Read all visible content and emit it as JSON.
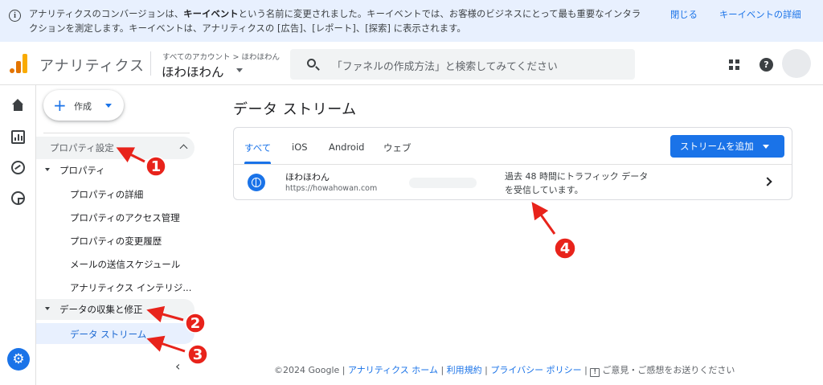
{
  "banner": {
    "message_pre": "アナリティクスのコンバージョンは、",
    "message_bold": "キーイベント",
    "message_post": "という名前に変更されました。キーイベントでは、お客様のビジネスにとって最も重要なインタラクションを測定します。キーイベントは、アナリティクスの [広告]、[レポート]、[探索] に表示されます。",
    "close_label": "閉じる",
    "details_label": "キーイベントの詳細"
  },
  "header": {
    "app_name": "アナリティクス",
    "breadcrumb": "すべてのアカウント > ほわほわん",
    "property_name": "ほわほわん",
    "search_placeholder": "「ファネルの作成方法」と検索してみてください"
  },
  "admin_nav": {
    "create_label": "作成",
    "section_label": "プロパティ設定",
    "group1_label": "プロパティ",
    "group1_items": [
      "プロパティの詳細",
      "プロパティのアクセス管理",
      "プロパティの変更履歴",
      "メールの送信スケジュール",
      "アナリティクス インテリジ..."
    ],
    "group2_label": "データの収集と修正",
    "group2_items": [
      "データ ストリーム"
    ]
  },
  "main": {
    "page_title": "データ ストリーム",
    "tabs": [
      "すべて",
      "iOS",
      "Android",
      "ウェブ"
    ],
    "add_stream_label": "ストリームを追加",
    "stream": {
      "name": "ほわほわん",
      "url": "https://howahowan.com",
      "status": "過去 48 時間にトラフィック データを受信しています。"
    }
  },
  "footer": {
    "copyright": "©2024 Google",
    "links": [
      "アナリティクス ホーム",
      "利用規約",
      "プライバシー ポリシー"
    ],
    "feedback": "ご意見・ご感想をお送りください"
  },
  "annotations": [
    "1",
    "2",
    "3",
    "4"
  ],
  "colors": {
    "accent": "#1a73e8",
    "annotation": "#e8231b",
    "banner_bg": "#e8f0fe"
  }
}
